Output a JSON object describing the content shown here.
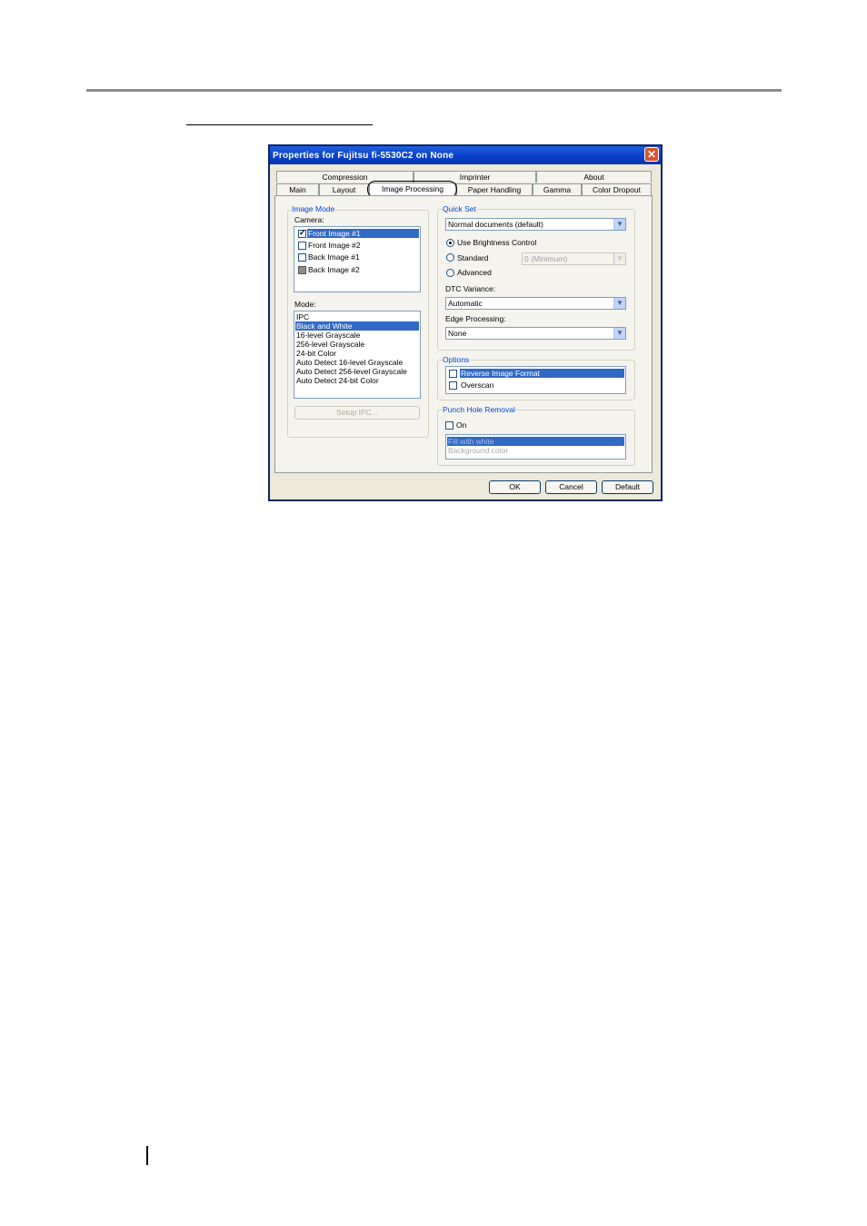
{
  "dialog": {
    "title": "Properties for Fujitsu fi-5530C2 on None",
    "close": "✕"
  },
  "tabs": {
    "row1": [
      "Compression",
      "Imprinter",
      "About"
    ],
    "row2": [
      "Main",
      "Layout",
      "Image Processing",
      "Paper Handling",
      "Gamma",
      "Color Dropout"
    ],
    "active": "Image Processing"
  },
  "image_mode": {
    "group_label": "Image Mode",
    "camera_label": "Camera:",
    "cameras": [
      {
        "label": "Front Image #1",
        "checked": true,
        "selected": true
      },
      {
        "label": "Front Image #2",
        "checked": false
      },
      {
        "label": "Back Image #1",
        "checked": false
      },
      {
        "label": "Back Image #2",
        "checked": false,
        "greyed": true
      }
    ],
    "mode_label": "Mode:",
    "modes": [
      "IPC",
      "Black and White",
      "16-level Grayscale",
      "256-level Grayscale",
      "24-bit Color",
      "Auto Detect 16-level Grayscale",
      "Auto Detect 256-level Grayscale",
      "Auto Detect 24-bit Color"
    ],
    "selected_mode": "Black and White",
    "setup_button": "Setup IPC..."
  },
  "quick_set": {
    "group_label": "Quick Set",
    "combo_value": "Normal documents (default)",
    "radio_brightness": "Use Brightness Control",
    "radio_standard": "Standard",
    "radio_advanced": "Advanced",
    "selected_radio": "Use Brightness Control",
    "standard_value": "0 (Minimum)",
    "dtc_label": "DTC Variance:",
    "dtc_value": "Automatic",
    "edge_label": "Edge Processing:",
    "edge_value": "None"
  },
  "options": {
    "group_label": "Options",
    "items": [
      {
        "label": "Reverse Image Format",
        "checked": false,
        "selected": true
      },
      {
        "label": "Overscan",
        "checked": false
      }
    ]
  },
  "punch_hole": {
    "group_label": "Punch Hole Removal",
    "on_label": "On",
    "on_checked": false,
    "fill_options": [
      "Fill with white",
      "Background color"
    ],
    "selected_fill": "Fill with white"
  },
  "buttons": {
    "ok": "OK",
    "cancel": "Cancel",
    "default": "Default"
  }
}
